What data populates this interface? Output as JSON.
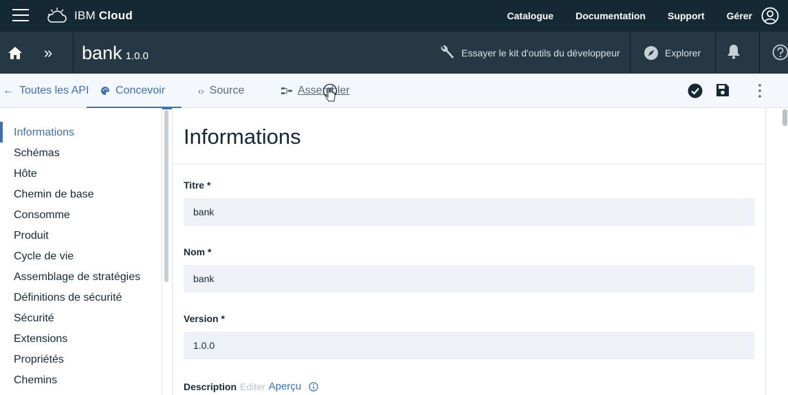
{
  "topbar": {
    "brand_prefix": "IBM",
    "brand_suffix": "Cloud",
    "nav": [
      "Catalogue",
      "Documentation",
      "Support",
      "Gérer"
    ]
  },
  "apibar": {
    "api_name": "bank",
    "api_version": "1.0.0",
    "dev_kit_label": "Essayer le kit d'outils du développeur",
    "explore_label": "Explorer"
  },
  "tabs": {
    "back": "Toutes les API",
    "designer": "Concevoir",
    "source": "Source",
    "assemble": "Assembler"
  },
  "sidebar": {
    "items": [
      {
        "label": "Informations",
        "active": true
      },
      {
        "label": "Schémas"
      },
      {
        "label": "Hôte"
      },
      {
        "label": "Chemin de base"
      },
      {
        "label": "Consomme"
      },
      {
        "label": "Produit"
      },
      {
        "label": "Cycle de vie"
      },
      {
        "label": "Assemblage de stratégies"
      },
      {
        "label": "Définitions de sécurité"
      },
      {
        "label": "Sécurité"
      },
      {
        "label": "Extensions"
      },
      {
        "label": "Propriétés"
      },
      {
        "label": "Chemins"
      }
    ]
  },
  "main": {
    "title": "Informations",
    "fields": [
      {
        "label": "Titre *",
        "value": "bank"
      },
      {
        "label": "Nom *",
        "value": "bank"
      },
      {
        "label": "Version *",
        "value": "1.0.0"
      }
    ],
    "description": {
      "label": "Description",
      "edit": "Editer",
      "preview": "Aperçu"
    }
  },
  "colors": {
    "topbar": "#152935",
    "apibar": "#253844",
    "accent": "#3d70b2",
    "input_bg": "#eef2f7"
  }
}
